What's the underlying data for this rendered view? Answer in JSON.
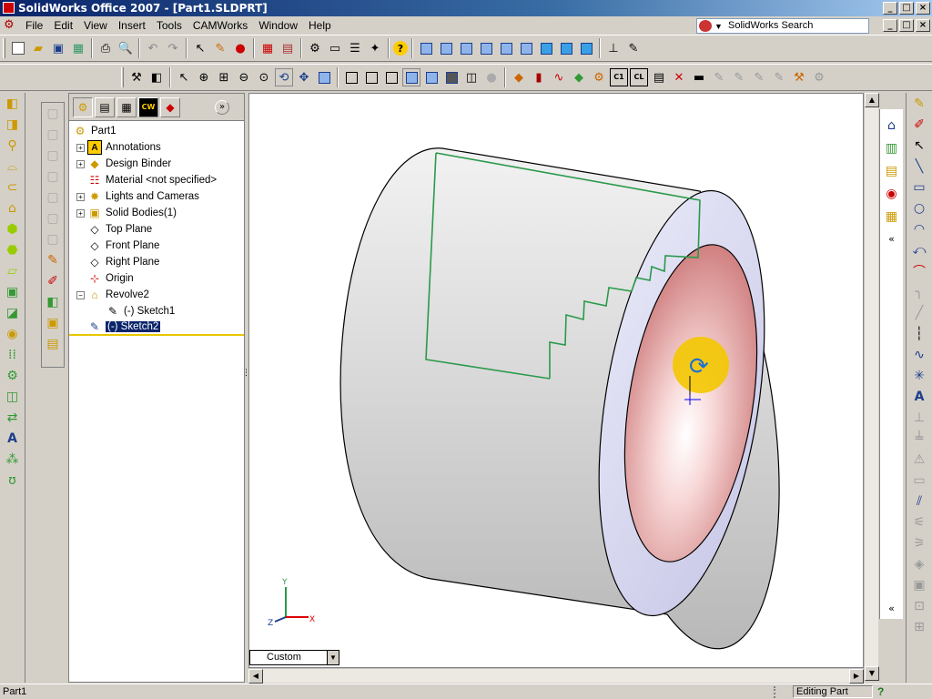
{
  "window": {
    "title": "SolidWorks Office 2007 - [Part1.SLDPRT]",
    "min": "_",
    "max": "□",
    "close": "×"
  },
  "menu": [
    "File",
    "Edit",
    "View",
    "Insert",
    "Tools",
    "CAMWorks",
    "Window",
    "Help"
  ],
  "search": {
    "placeholder": "SolidWorks Search"
  },
  "feature_tree": {
    "root": "Part1",
    "items": [
      {
        "label": "Annotations",
        "icon": "annotations-icon",
        "expandable": true
      },
      {
        "label": "Design Binder",
        "icon": "design-binder-icon",
        "expandable": true
      },
      {
        "label": "Material <not specified>",
        "icon": "material-icon",
        "expandable": false
      },
      {
        "label": "Lights and Cameras",
        "icon": "lights-cameras-icon",
        "expandable": true
      },
      {
        "label": "Solid Bodies(1)",
        "icon": "solid-bodies-icon",
        "expandable": true
      },
      {
        "label": "Top Plane",
        "icon": "plane-icon",
        "expandable": false
      },
      {
        "label": "Front Plane",
        "icon": "plane-icon",
        "expandable": false
      },
      {
        "label": "Right Plane",
        "icon": "plane-icon",
        "expandable": false
      },
      {
        "label": "Origin",
        "icon": "origin-icon",
        "expandable": false
      },
      {
        "label": "Revolve2",
        "icon": "revolve-icon",
        "expandable": true,
        "expanded": true
      },
      {
        "label": "(-) Sketch1",
        "icon": "sketch-icon",
        "child": true
      },
      {
        "label": "(-) Sketch2",
        "icon": "sketch-icon",
        "selected": true
      }
    ]
  },
  "viewport": {
    "view_orientation": "Custom",
    "axes": {
      "x": "X",
      "y": "Y",
      "z": "Z"
    }
  },
  "status": {
    "left": "Part1",
    "mode": "Editing Part",
    "help_icon": "?"
  }
}
